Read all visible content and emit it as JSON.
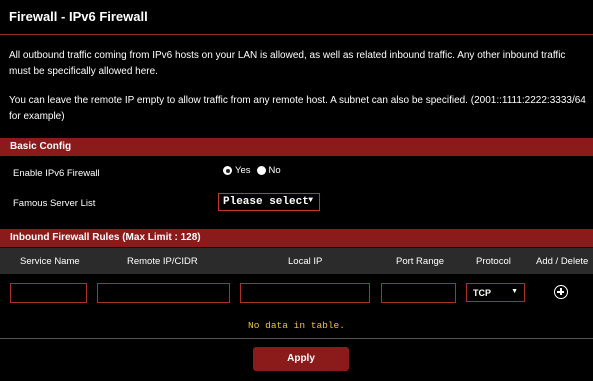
{
  "title": "Firewall - IPv6 Firewall",
  "description": {
    "line1": "All outbound traffic coming from IPv6 hosts on your LAN is allowed, as well as related inbound traffic. Any other inbound traffic must be specifically allowed here.",
    "line2": "You can leave the remote IP empty to allow traffic from any remote host. A subnet can also be specified. (2001::1111:2222:3333/64 for example)"
  },
  "basic_config": {
    "header": "Basic Config",
    "enable_label": "Enable IPv6 Firewall",
    "yes_label": "Yes",
    "no_label": "No",
    "enabled": "Yes",
    "famous_server_label": "Famous Server List",
    "famous_server_value": "Please select"
  },
  "inbound_rules": {
    "header": "Inbound Firewall Rules (Max Limit : 128)",
    "columns": [
      "Service Name",
      "Remote IP/CIDR",
      "Local IP",
      "Port Range",
      "Protocol",
      "Add / Delete"
    ],
    "protocol_value": "TCP",
    "empty_text": "No data in table."
  },
  "apply_label": "Apply",
  "colors": {
    "accent": "#8b1a1a",
    "input_border": "#a93226",
    "empty_text": "#f0c040"
  },
  "icons": {
    "add": "plus-circle-icon",
    "dropdown": "triangle-down-icon"
  }
}
